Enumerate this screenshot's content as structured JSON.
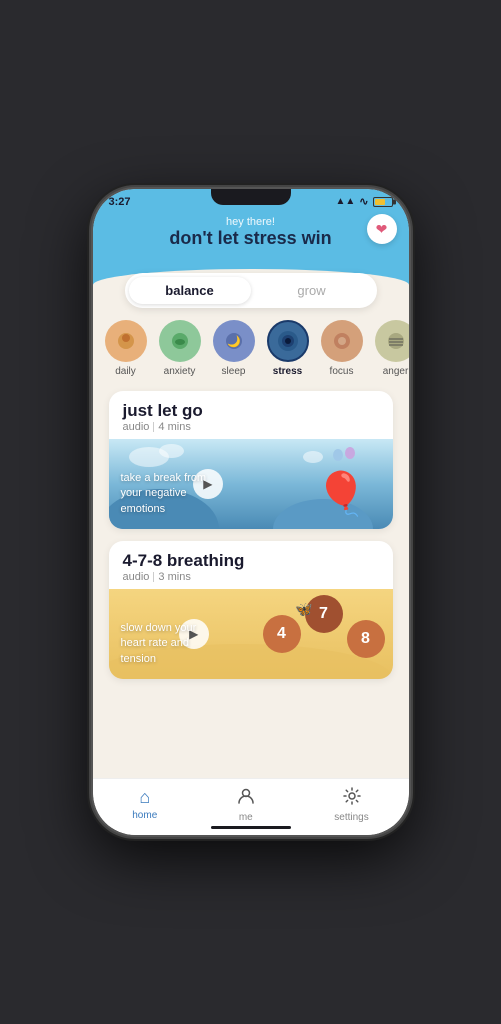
{
  "status": {
    "time": "3:27",
    "signal_icon": "📶",
    "wifi_icon": "WiFi",
    "battery_level": 60
  },
  "header": {
    "greeting": "hey there!",
    "title": "don't let stress win",
    "heart_icon": "❤"
  },
  "tabs": {
    "balance": "balance",
    "grow": "grow"
  },
  "categories": [
    {
      "id": "daily",
      "label": "daily",
      "emoji": "🟠",
      "color": "#e8b07a",
      "selected": false
    },
    {
      "id": "anxiety",
      "label": "anxiety",
      "emoji": "🟢",
      "color": "#8ec89a",
      "selected": false
    },
    {
      "id": "sleep",
      "label": "sleep",
      "emoji": "🌙",
      "color": "#7a8fc8",
      "selected": false
    },
    {
      "id": "stress",
      "label": "stress",
      "emoji": "◉",
      "color": "#3a6a9a",
      "selected": true
    },
    {
      "id": "focus",
      "label": "focus",
      "emoji": "⊙",
      "color": "#d4a07a",
      "selected": false
    },
    {
      "id": "anger",
      "label": "anger",
      "emoji": "〰",
      "color": "#c8c8a0",
      "selected": false
    }
  ],
  "cards": [
    {
      "id": "just-let-go",
      "title": "just let go",
      "type": "audio",
      "duration": "4 mins",
      "overlay_text": "take a break from your negative emotions",
      "play_icon": "▶"
    },
    {
      "id": "breathing",
      "title": "4-7-8 breathing",
      "type": "audio",
      "duration": "3 mins",
      "overlay_text": "slow down your heart rate and tension",
      "play_icon": "▶",
      "numbers": [
        "4",
        "7",
        "8"
      ]
    }
  ],
  "nav": [
    {
      "id": "home",
      "label": "home",
      "icon": "🏠",
      "active": true
    },
    {
      "id": "me",
      "label": "me",
      "icon": "👤",
      "active": false
    },
    {
      "id": "settings",
      "label": "settings",
      "icon": "⚙",
      "active": false
    }
  ],
  "colors": {
    "sky": "#5bbce4",
    "sand": "#e8d5a0",
    "card_bg": "#ffffff",
    "page_bg": "#f5f0e8",
    "accent": "#3a7abd",
    "text_dark": "#1a1a2e"
  }
}
